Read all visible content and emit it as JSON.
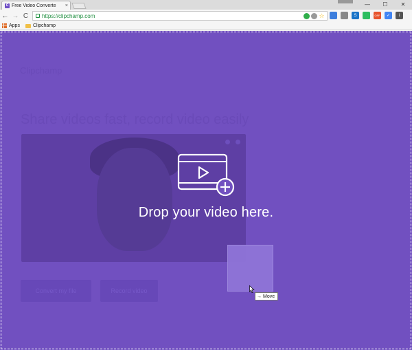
{
  "browser": {
    "tab_title": "Free Video Converte",
    "tab_favicon": "C",
    "tab_close": "×",
    "window_controls": [
      "—",
      "☐",
      "✕"
    ],
    "url": "https://clipchamp.com",
    "nav": {
      "back": "←",
      "forward": "→",
      "reload": "C"
    },
    "extensions": [
      {
        "name": "shield-extension-icon",
        "color": "#3b7ddd",
        "glyph": ""
      },
      {
        "name": "ext-gray-icon",
        "color": "#888888",
        "glyph": ""
      },
      {
        "name": "skype-extension-icon",
        "color": "#1a74c8",
        "glyph": "S"
      },
      {
        "name": "evernote-extension-icon",
        "color": "#2dbe60",
        "glyph": ""
      },
      {
        "name": "off-extension-icon",
        "color": "#e8542e",
        "glyph": "OFF"
      },
      {
        "name": "check-extension-icon",
        "color": "#4285f4",
        "glyph": "✓"
      },
      {
        "name": "info-extension-icon",
        "color": "#555555",
        "glyph": "i"
      }
    ],
    "bookmarks": [
      {
        "label": "Apps",
        "icon": "apps-grid-icon"
      },
      {
        "label": "Clipchamp",
        "icon": "folder-icon"
      }
    ]
  },
  "page": {
    "background_brand": "Clipchamp",
    "background_headline": "Share videos fast, record video easily",
    "background_buttons": [
      "Convert my file",
      "Record video"
    ],
    "drop_text": "Drop your video here.",
    "drag_tooltip": "Move",
    "colors": {
      "overlay": "#7150c0",
      "ghost": "#8f74d8",
      "text": "#ffffff"
    }
  }
}
